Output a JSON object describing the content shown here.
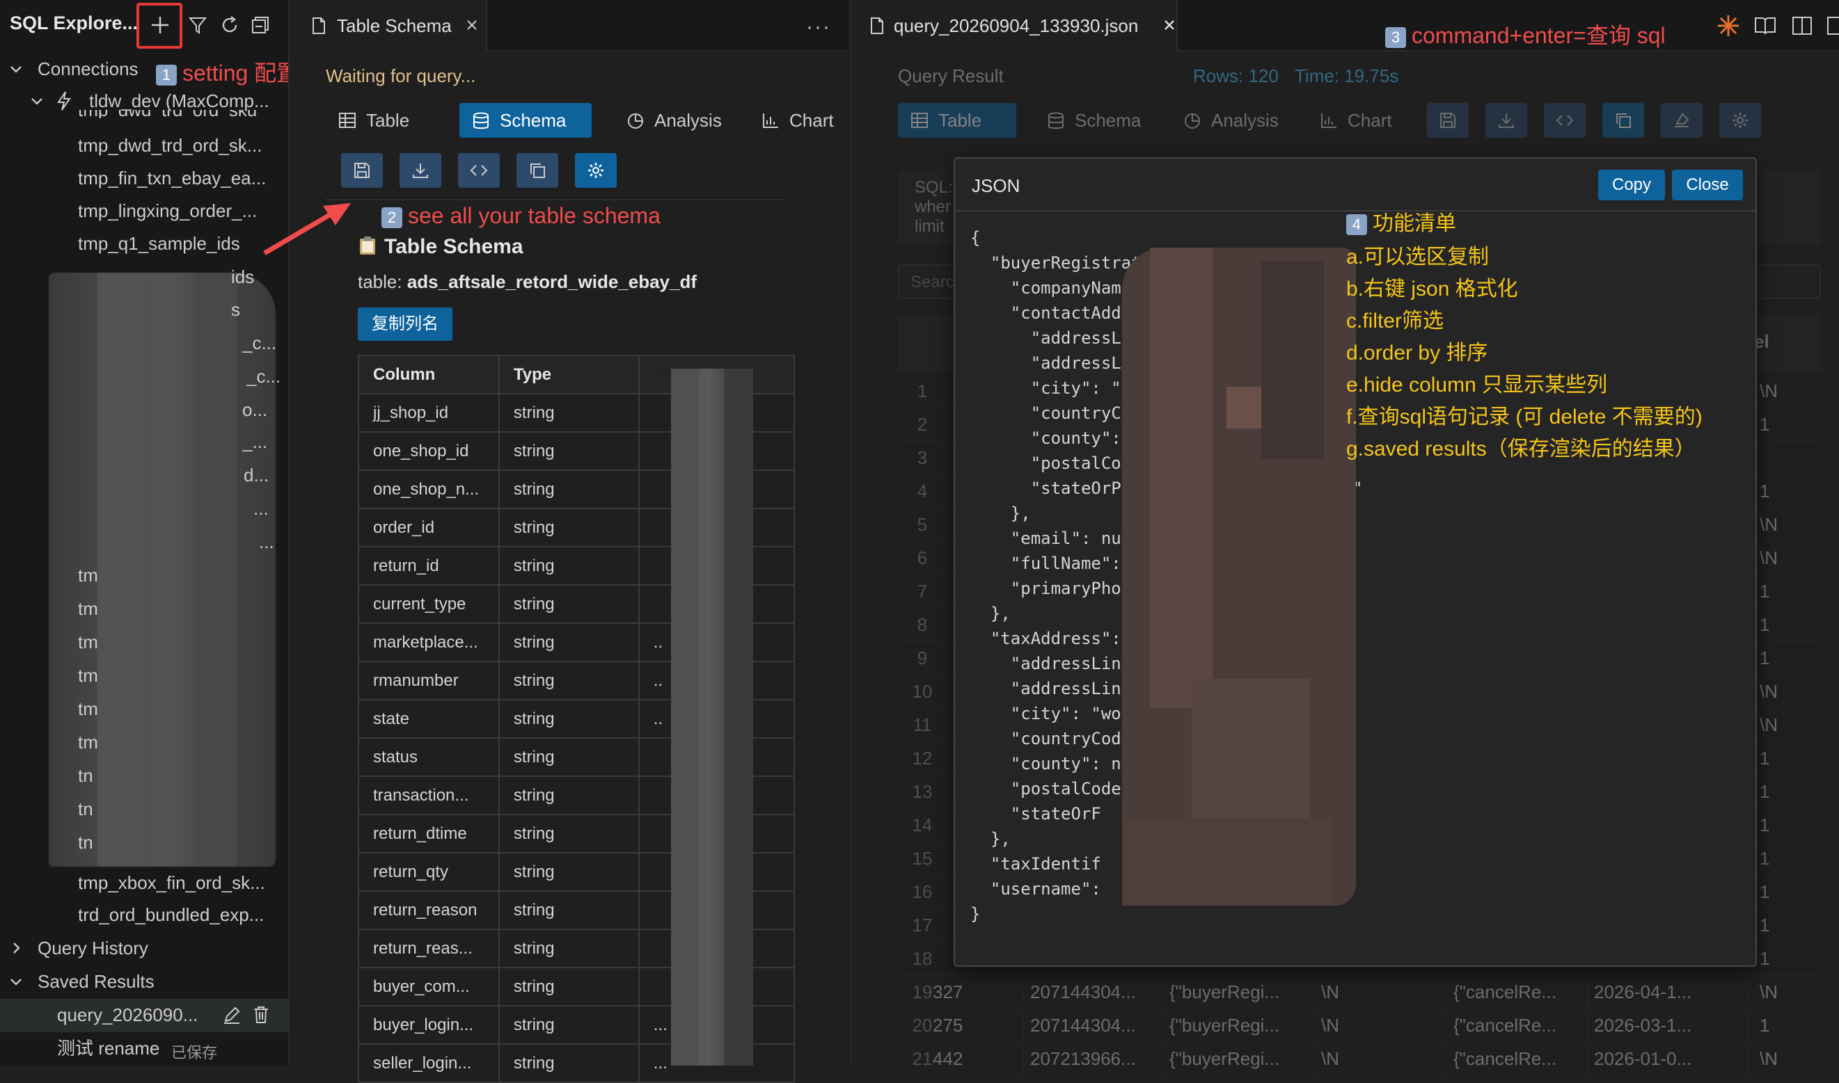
{
  "sidebar": {
    "title": "SQL Explore...",
    "connections_label": "Connections",
    "connection_name": "tldw_dev (MaxComp...",
    "tables": [
      "tmp_dwd_trd_ord_sk...",
      "tmp_fin_txn_ebay_ea...",
      "tmp_lingxing_order_...",
      "tmp_q1_sample_ids"
    ],
    "partial_items": [
      "ids",
      "s",
      "_c...",
      "_c...",
      "o...",
      "_...",
      "d...",
      "...",
      "..."
    ],
    "tm_rows": [
      "tm",
      "tm",
      "tm",
      "tm",
      "tm",
      "tm",
      "tn",
      "tn",
      "tn"
    ],
    "lower_tables": [
      "tmp_xbox_fin_ord_sk...",
      "trd_ord_bundled_exp..."
    ],
    "query_history_label": "Query History",
    "saved_results_label": "Saved Results",
    "saved_items": [
      {
        "name": "query_2026090...",
        "tag": ""
      },
      {
        "name": "测试 rename",
        "tag": "已保存"
      }
    ]
  },
  "annotations": {
    "a1_num": "1",
    "a1_text": "setting 配置",
    "a2_num": "2",
    "a2_text": "see all your table schema",
    "a3_num": "3",
    "a3_text": "command+enter=查询 sql",
    "a4_num": "4",
    "a4_title": "功能清单",
    "features": [
      "a.可以选区复制",
      "b.右键 json 格式化",
      "c.filter筛选",
      "d.order by 排序",
      "e.hide column 只显示某些列",
      "f.查询sql语句记录 (可 delete 不需要的)",
      "g.saved results（保存渲染后的结果）"
    ]
  },
  "middle": {
    "tab_title": "Table Schema",
    "status": "Waiting for query...",
    "view_tabs": [
      "Table",
      "Schema",
      "Analysis",
      "Chart"
    ],
    "active_view": "Schema",
    "schema_heading": "Table Schema",
    "table_prefix": "table: ",
    "table_name": "ads_aftsale_retord_wide_ebay_df",
    "copy_columns_btn": "复制列名",
    "headers": [
      "Column",
      "Type",
      "Comment"
    ],
    "rows": [
      {
        "column": "jj_shop_id",
        "type": "string",
        "comment": ""
      },
      {
        "column": "one_shop_id",
        "type": "string",
        "comment": ""
      },
      {
        "column": "one_shop_n...",
        "type": "string",
        "comment": ""
      },
      {
        "column": "order_id",
        "type": "string",
        "comment": ""
      },
      {
        "column": "return_id",
        "type": "string",
        "comment": ""
      },
      {
        "column": "current_type",
        "type": "string",
        "comment": ""
      },
      {
        "column": "marketplace...",
        "type": "string",
        "comment": ".."
      },
      {
        "column": "rmanumber",
        "type": "string",
        "comment": ".."
      },
      {
        "column": "state",
        "type": "string",
        "comment": ".."
      },
      {
        "column": "status",
        "type": "string",
        "comment": ""
      },
      {
        "column": "transaction...",
        "type": "string",
        "comment": ""
      },
      {
        "column": "return_dtime",
        "type": "string",
        "comment": ""
      },
      {
        "column": "return_qty",
        "type": "string",
        "comment": ""
      },
      {
        "column": "return_reason",
        "type": "string",
        "comment": ""
      },
      {
        "column": "return_reas...",
        "type": "string",
        "comment": ""
      },
      {
        "column": "buyer_com...",
        "type": "string",
        "comment": ""
      },
      {
        "column": "buyer_login...",
        "type": "string",
        "comment": "..."
      },
      {
        "column": "seller_login...",
        "type": "string",
        "comment": "..."
      }
    ]
  },
  "right": {
    "tab_title": "query_20260904_133930.json",
    "query_result_label": "Query Result",
    "rows_label": "Rows: 120",
    "time_label": "Time: 19.75s",
    "view_tabs": [
      "Table",
      "Schema",
      "Analysis",
      "Chart"
    ],
    "sql_lines": [
      "SQL:",
      "wher",
      "limit"
    ],
    "search_placeholder": "Search",
    "col_more": "...",
    "col_last": "el",
    "grid_rows": [
      {
        "n": "1",
        "last": "\\N"
      },
      {
        "n": "2",
        "last": "1"
      },
      {
        "n": "3",
        "last": ""
      },
      {
        "n": "4",
        "last": "1"
      },
      {
        "n": "5",
        "last": "\\N"
      },
      {
        "n": "6",
        "last": "\\N"
      },
      {
        "n": "7",
        "last": "1"
      },
      {
        "n": "8",
        "last": "1"
      },
      {
        "n": "9",
        "last": "1"
      },
      {
        "n": "10",
        "last": "\\N"
      },
      {
        "n": "11",
        "last": "\\N"
      },
      {
        "n": "12",
        "last": "1"
      },
      {
        "n": "13",
        "last": "1"
      },
      {
        "n": "14",
        "last": "1"
      },
      {
        "n": "15",
        "last": "1"
      },
      {
        "n": "16",
        "last": "1"
      },
      {
        "n": "17",
        "last": "1"
      },
      {
        "n": "18",
        "last": "1"
      }
    ],
    "full_rows": [
      {
        "n": "19",
        "a": "327",
        "b": "207144304...",
        "c": "{\"buyerRegi...",
        "d": "\\N",
        "e": "{\"cancelRe...",
        "f": "2026-04-1...",
        "g": "\\N"
      },
      {
        "n": "20",
        "a": "275",
        "b": "207144304...",
        "c": "{\"buyerRegi...",
        "d": "\\N",
        "e": "{\"cancelRe...",
        "f": "2026-03-1...",
        "g": "1"
      },
      {
        "n": "21",
        "a": "442",
        "b": "207213966...",
        "c": "{\"buyerRegi...",
        "d": "\\N",
        "e": "{\"cancelRe...",
        "f": "2026-01-0...",
        "g": "\\N"
      }
    ]
  },
  "modal": {
    "title": "JSON",
    "copy_btn": "Copy",
    "close_btn": "Close",
    "json_lines": [
      "{",
      "  \"buyerRegistratic",
      "    \"companyName\":",
      "    \"contactAddre",
      "      \"addressLir",
      "      \"addressLi",
      "      \"city\": \"v",
      "      \"countryC",
      "      \"county\":",
      "      \"postalCo",
      "      \"stateOrP                  shire\"",
      "    },",
      "    \"email\": nu",
      "    \"fullName\":",
      "    \"primaryPho",
      "  },",
      "  \"taxAddress\":",
      "    \"addressLin",
      "    \"addressLin",
      "    \"city\": \"wo",
      "    \"countryCode",
      "    \"county\": nu",
      "    \"postalCode\"",
      "    \"stateOrF                      e\"",
      "  },",
      "  \"taxIdentif",
      "  \"username\":",
      "}"
    ]
  },
  "colors": {
    "accent": "#0e639c",
    "annotation_red": "#f14c4c",
    "annotation_yellow": "#f5c518"
  }
}
